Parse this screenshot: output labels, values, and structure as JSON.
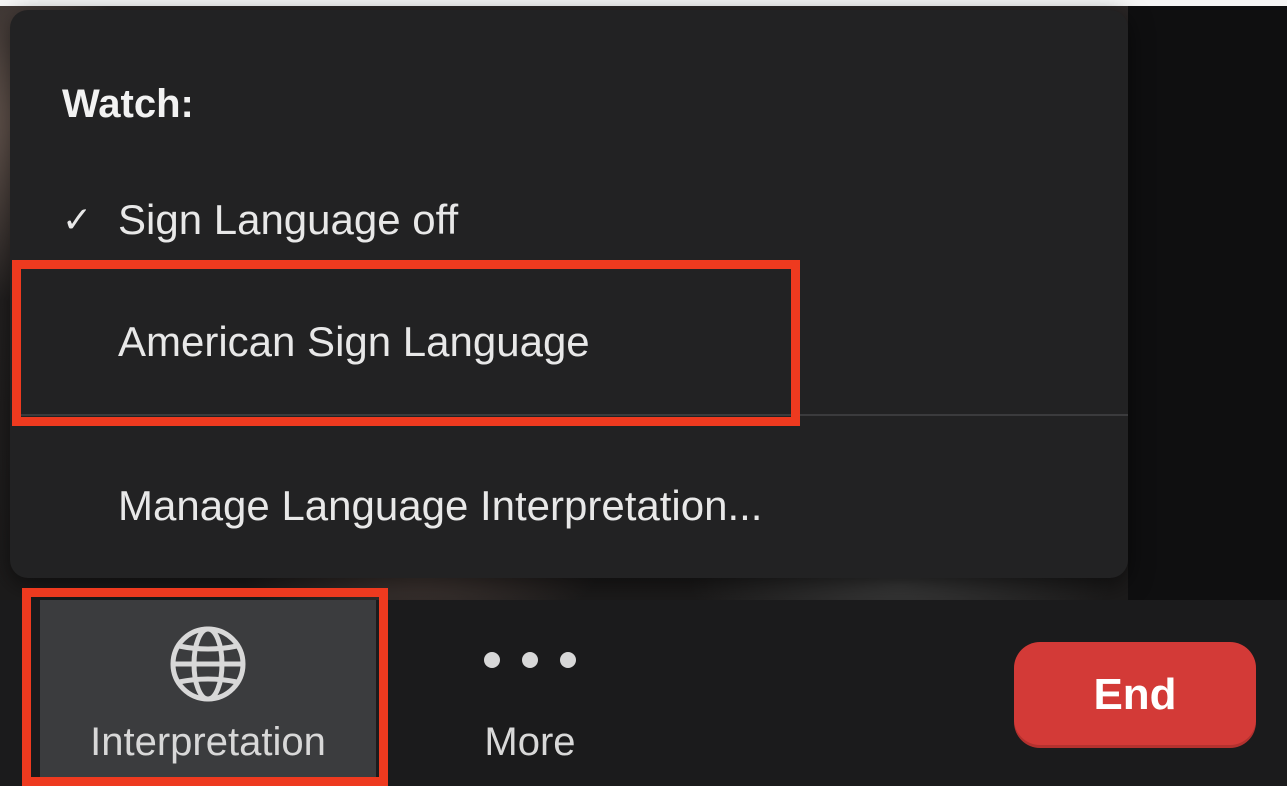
{
  "menu": {
    "header": "Watch:",
    "items": [
      {
        "label": "Sign Language off",
        "checked": true
      },
      {
        "label": "American Sign Language",
        "checked": false,
        "highlighted": true
      },
      {
        "label": "Manage Language Interpretation...",
        "checked": false
      }
    ],
    "check_glyph": "✓"
  },
  "toolbar": {
    "interpretation": {
      "label": "Interpretation",
      "icon": "globe-icon",
      "highlighted": true
    },
    "more": {
      "label": "More",
      "icon": "more-dots-icon"
    },
    "end": {
      "label": "End"
    }
  },
  "colors": {
    "highlight": "#ee3a1f",
    "end_button": "#d33a37",
    "menu_bg": "#222223",
    "toolbar_bg": "#1b1b1c"
  }
}
